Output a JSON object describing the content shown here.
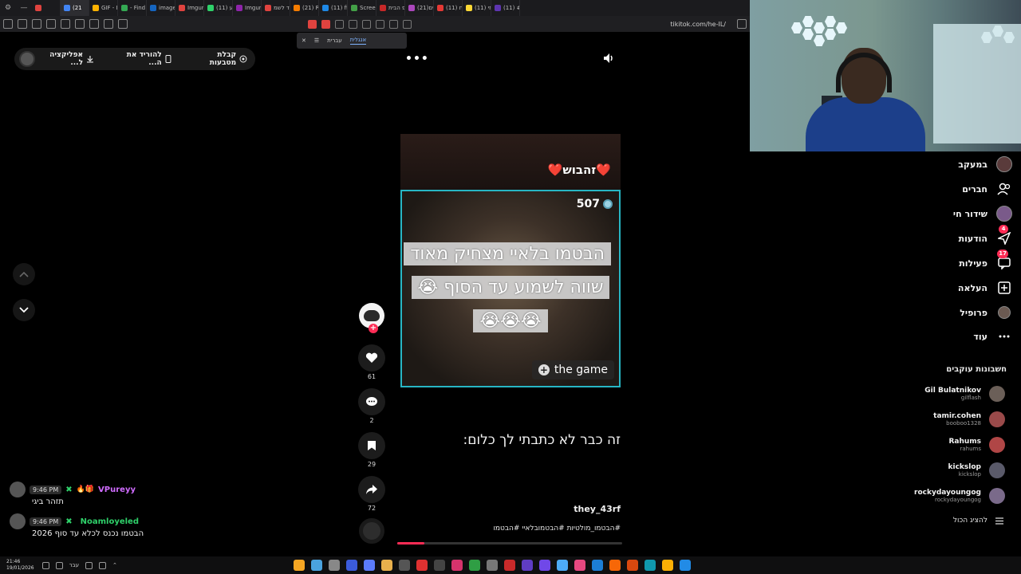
{
  "browser": {
    "tabs": [
      "",
      "(21",
      "GIF - Im",
      "- Find & T",
      "image.png",
      "Imgur: The",
      "(11) אירוע",
      "Imgur: The",
      "פחד לשמ",
      "(21) Ramé",
      "(11) first",
      "Screenshot",
      "חטופ הבית",
      "(21)ירושים",
      "(11) מלח",
      "(11) חוזי",
      "(11) #dem"
    ],
    "url": "tikitok.com/he-IL/"
  },
  "translate_bar": {
    "close": "✕",
    "menu": "☰",
    "lang_from": "עברית",
    "lang_to": "אנגלית"
  },
  "top_pill": {
    "get_coins": "קבלת מטבעות",
    "download": "להוריד את ה...",
    "app": "אפליקציה ל..."
  },
  "video": {
    "heart_text": "❤️זהבוש❤️",
    "count": "507",
    "caption": "הבטמו בלאיי מצחיק מאוד שווה לשמוע עד הסוף 😭😭😭😭",
    "game_label": "the game",
    "game_plus": "+",
    "subtitle": "זה כבר לא כתבתי לך כלום:",
    "author": "they_43rf",
    "hashtags": "#הבטמו_מולטיות #הבטמובלאיי #הבטמו",
    "progress": 0.12
  },
  "actions": {
    "likes": "61",
    "comments": "2",
    "saves": "29",
    "shares": "72",
    "follow_plus": "+"
  },
  "sidebar": {
    "items": [
      {
        "label": "במעקב",
        "icon": "following-avatar-icon"
      },
      {
        "label": "חברים",
        "icon": "friends-icon"
      },
      {
        "label": "שידור חי",
        "icon": "live-icon"
      },
      {
        "label": "הודעות",
        "icon": "messages-icon",
        "badge": "4"
      },
      {
        "label": "פעילות",
        "icon": "activity-icon",
        "badge": "17"
      },
      {
        "label": "העלאה",
        "icon": "upload-icon"
      },
      {
        "label": "פרופיל",
        "icon": "profile-icon"
      },
      {
        "label": "עוד",
        "icon": "more-icon"
      }
    ],
    "following_title": "חשבונות עוקבים",
    "accounts": [
      {
        "name": "Gil Bulatnikov",
        "handle": "gilflash"
      },
      {
        "name": "tamir.cohen",
        "handle": "booboo1328"
      },
      {
        "name": "Rahums",
        "handle": "rahums"
      },
      {
        "name": "kickslop",
        "handle": "kickslop"
      },
      {
        "name": "rockydayoungog",
        "handle": "rockydayoungog"
      }
    ],
    "show_all": "להציג הכול"
  },
  "chat": [
    {
      "time": "9:46 PM",
      "user": "VPureyy",
      "user_color": "#d06cff",
      "badges": "🔥🎁",
      "message": "תזהר ביגי"
    },
    {
      "time": "9:46 PM",
      "user": "Noamloyeled",
      "user_color": "#2fd16a",
      "badges": "",
      "message": "הבטמו נכנס לכלא עד סוף 2026"
    }
  ],
  "taskbar": {
    "time": "21:46",
    "date": "19/01/2026",
    "lang": "עבר"
  }
}
